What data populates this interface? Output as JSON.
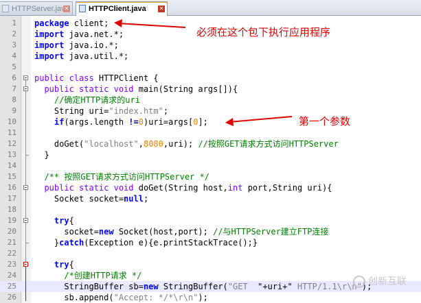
{
  "tabs": [
    {
      "label": "HTTPServer.java",
      "active": false
    },
    {
      "label": "HTTPClient.java",
      "active": true
    }
  ],
  "close_glyph": "✕",
  "annotations": {
    "package_note": "必须在这个包下执行应用程序",
    "args_note": "第一个参数"
  },
  "watermark": {
    "text": "创新互联"
  },
  "lines": [
    {
      "n": "1",
      "tokens": [
        [
          "kw",
          "package"
        ],
        [
          "pl",
          " client;"
        ]
      ]
    },
    {
      "n": "2",
      "tokens": [
        [
          "kw",
          "import"
        ],
        [
          "pl",
          " java.net.*;"
        ]
      ]
    },
    {
      "n": "3",
      "tokens": [
        [
          "kw",
          "import"
        ],
        [
          "pl",
          " java.io.*;"
        ]
      ]
    },
    {
      "n": "4",
      "tokens": [
        [
          "kw",
          "import"
        ],
        [
          "pl",
          " java.util.*;"
        ]
      ]
    },
    {
      "n": "5",
      "tokens": []
    },
    {
      "n": "6",
      "tokens": [
        [
          "kw2",
          "public class"
        ],
        [
          "pl",
          " HTTPClient {"
        ]
      ]
    },
    {
      "n": "7",
      "tokens": [
        [
          "pl",
          "  "
        ],
        [
          "kw2",
          "public static void"
        ],
        [
          "pl",
          " main(String args[]){"
        ]
      ]
    },
    {
      "n": "8",
      "tokens": [
        [
          "pl",
          "    "
        ],
        [
          "cm",
          "//确定HTTP请求的uri"
        ]
      ]
    },
    {
      "n": "9",
      "tokens": [
        [
          "pl",
          "    String uri="
        ],
        [
          "str",
          "\"index.htm\""
        ],
        [
          "pl",
          ";"
        ]
      ]
    },
    {
      "n": "10",
      "tokens": [
        [
          "pl",
          "    "
        ],
        [
          "kw",
          "if"
        ],
        [
          "pl",
          "(args.length "
        ],
        [
          "op",
          "!="
        ],
        [
          "num",
          "0"
        ],
        [
          "pl",
          ")uri=args["
        ],
        [
          "num",
          "0"
        ],
        [
          "pl",
          "];"
        ]
      ]
    },
    {
      "n": "11",
      "tokens": []
    },
    {
      "n": "12",
      "tokens": [
        [
          "pl",
          "    doGet("
        ],
        [
          "str",
          "\"localhost\""
        ],
        [
          "pl",
          ","
        ],
        [
          "num",
          "8080"
        ],
        [
          "pl",
          ",uri); "
        ],
        [
          "cm",
          "//按照GET请求方式访问HTTPServer"
        ]
      ]
    },
    {
      "n": "13",
      "tokens": [
        [
          "pl",
          "  }"
        ]
      ]
    },
    {
      "n": "14",
      "tokens": []
    },
    {
      "n": "15",
      "tokens": [
        [
          "pl",
          "  "
        ],
        [
          "cm",
          "/** 按照GET请求方式访问HTTPServer */"
        ]
      ]
    },
    {
      "n": "16",
      "tokens": [
        [
          "pl",
          "  "
        ],
        [
          "kw2",
          "public static void"
        ],
        [
          "pl",
          " doGet(String host,"
        ],
        [
          "kw2",
          "int"
        ],
        [
          "pl",
          " port,String uri){"
        ]
      ]
    },
    {
      "n": "17",
      "tokens": [
        [
          "pl",
          "    Socket socket="
        ],
        [
          "kw",
          "null"
        ],
        [
          "pl",
          ";"
        ]
      ]
    },
    {
      "n": "18",
      "tokens": []
    },
    {
      "n": "19",
      "tokens": [
        [
          "pl",
          "    "
        ],
        [
          "kw",
          "try"
        ],
        [
          "pl",
          "{"
        ]
      ]
    },
    {
      "n": "20",
      "tokens": [
        [
          "pl",
          "      socket="
        ],
        [
          "kw",
          "new"
        ],
        [
          "pl",
          " Socket(host,port); "
        ],
        [
          "cm",
          "//与HTTPServer建立FTP连接"
        ]
      ]
    },
    {
      "n": "21",
      "tokens": [
        [
          "pl",
          "    }"
        ],
        [
          "kw",
          "catch"
        ],
        [
          "pl",
          "(Exception e){e.printStackTrace();}"
        ]
      ]
    },
    {
      "n": "22",
      "tokens": []
    },
    {
      "n": "23",
      "tokens": [
        [
          "pl",
          "    "
        ],
        [
          "kw",
          "try"
        ],
        [
          "pl",
          "{"
        ]
      ]
    },
    {
      "n": "24",
      "tokens": [
        [
          "pl",
          "      "
        ],
        [
          "cm",
          "/*创建HTTP请求 */"
        ]
      ]
    },
    {
      "n": "25",
      "tokens": [
        [
          "pl",
          "      StringBuffer sb="
        ],
        [
          "kw",
          "new"
        ],
        [
          "pl",
          " StringBuffer("
        ],
        [
          "str",
          "\"GET "
        ],
        [
          "pl",
          " \"+uri+\" "
        ],
        [
          "str",
          "HTTP/1.1\\r\\n\""
        ],
        [
          "pl",
          ");"
        ]
      ]
    },
    {
      "n": "26",
      "tokens": [
        [
          "pl",
          "      sb.append("
        ],
        [
          "str",
          "\"Accept: */*\\r\\n\""
        ],
        [
          "pl",
          ");"
        ]
      ]
    }
  ],
  "highlighted_line": "25"
}
